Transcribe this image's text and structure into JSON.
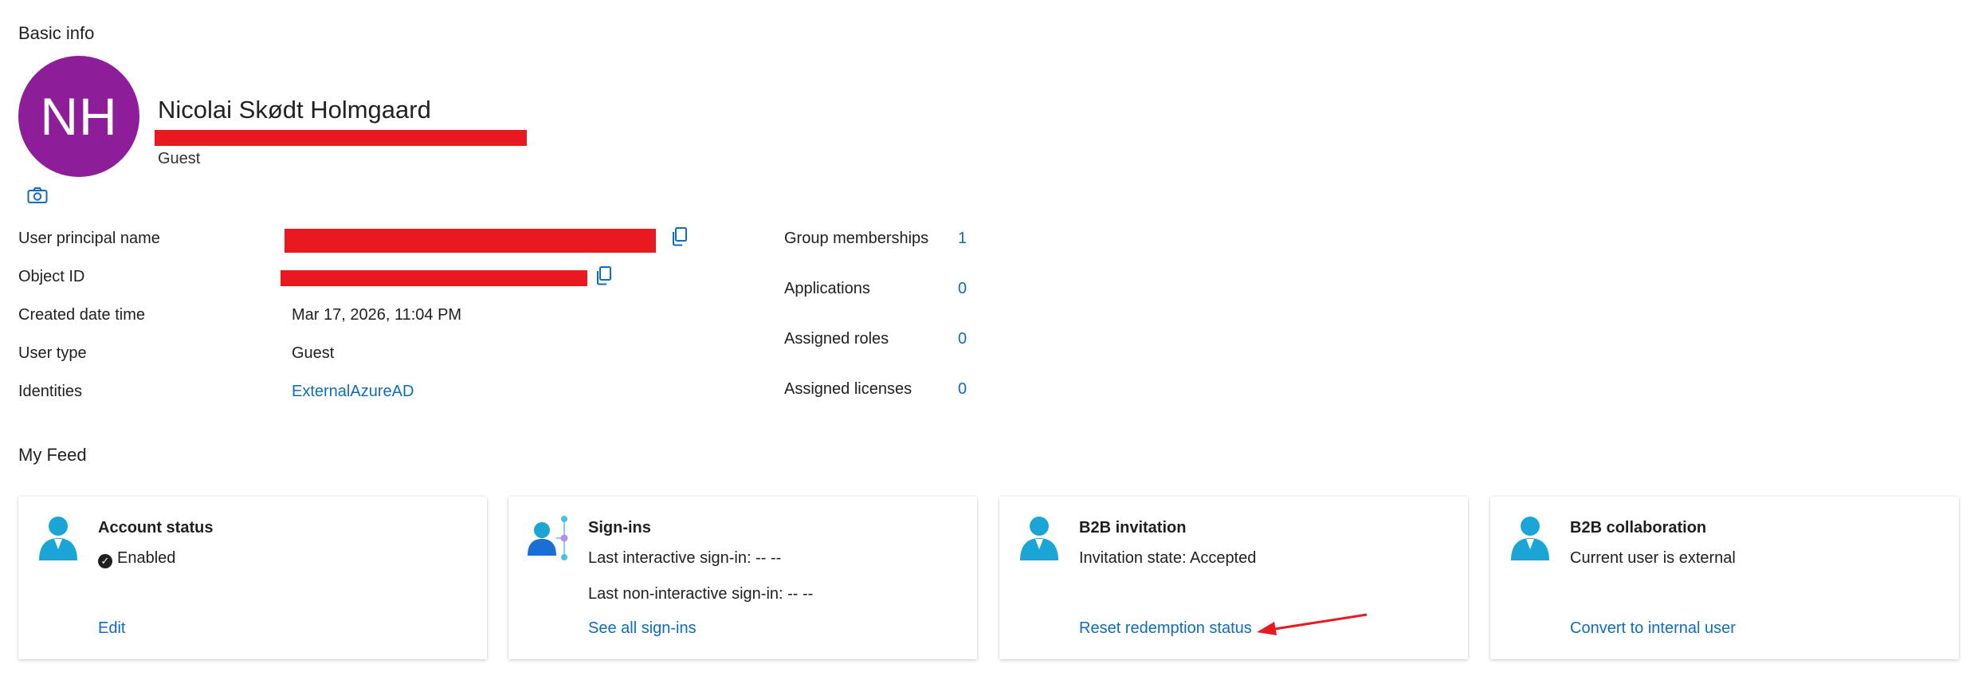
{
  "basic_info": {
    "section_title": "Basic info",
    "avatar_initials": "NH",
    "avatar_color": "#8d1d99",
    "display_name": "Nicolai Skødt Holmgaard",
    "user_type_caption": "Guest",
    "camera_icon": "camera-icon"
  },
  "properties": {
    "upn_label": "User principal name",
    "object_id_label": "Object ID",
    "created_label": "Created date time",
    "created_value": "Mar 17, 2026, 11:04 PM",
    "user_type_label": "User type",
    "user_type_value": "Guest",
    "identities_label": "Identities",
    "identities_value": "ExternalAzureAD"
  },
  "stats": {
    "groups_label": "Group memberships",
    "groups_value": "1",
    "apps_label": "Applications",
    "apps_value": "0",
    "roles_label": "Assigned roles",
    "roles_value": "0",
    "licenses_label": "Assigned licenses",
    "licenses_value": "0"
  },
  "feed": {
    "section_title": "My Feed",
    "cards": [
      {
        "title": "Account status",
        "line1": "Enabled",
        "link": "Edit",
        "icon": "user-icon"
      },
      {
        "title": "Sign-ins",
        "line1": "Last interactive sign-in: -- --",
        "line2": "Last non-interactive sign-in: -- --",
        "link": "See all sign-ins",
        "icon": "sign-ins-icon"
      },
      {
        "title": "B2B invitation",
        "line1": "Invitation state: Accepted",
        "link": "Reset redemption status",
        "icon": "user-icon"
      },
      {
        "title": "B2B collaboration",
        "line1": "Current user is external",
        "link": "Convert to internal user",
        "icon": "user-icon"
      }
    ]
  },
  "colors": {
    "link": "#0f6cbd",
    "redaction": "#e8191f",
    "annotation_arrow": "#e8191f"
  }
}
